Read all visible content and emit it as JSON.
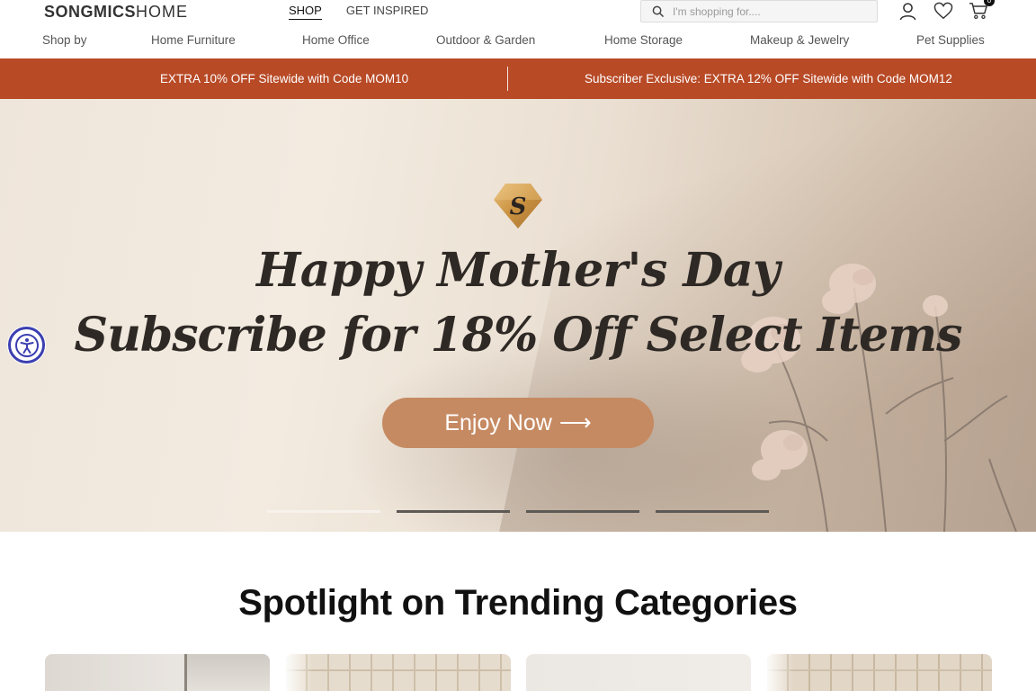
{
  "header": {
    "logo_bold": "SONGMICS",
    "logo_light": "HOME",
    "nav": [
      {
        "label": "SHOP",
        "active": true
      },
      {
        "label": "GET INSPIRED",
        "active": false
      }
    ],
    "search_placeholder": "I'm shopping for....",
    "cart_count": "0",
    "icons": [
      "search-icon",
      "account-icon",
      "heart-icon",
      "cart-icon"
    ]
  },
  "category_nav": [
    "Shop by",
    "Home Furniture",
    "Home Office",
    "Outdoor & Garden",
    "Home Storage",
    "Makeup & Jewelry",
    "Pet Supplies"
  ],
  "promo": {
    "left": "EXTRA 10% OFF Sitewide with Code MOM10",
    "right": "Subscriber Exclusive: EXTRA 12% OFF Sitewide with Code MOM12",
    "color": "#b84a26"
  },
  "hero": {
    "badge_letter": "S",
    "line1": "Happy Mother's Day",
    "line2": "Subscribe for 18% Off Select Items",
    "button_label": "Enjoy Now",
    "button_arrow": "⟶",
    "slides": 4,
    "active_slide": 1,
    "button_color": "#c68a62"
  },
  "section": {
    "title": "Spotlight on Trending Categories"
  },
  "accessibility": {
    "icon": "accessibility-icon"
  }
}
